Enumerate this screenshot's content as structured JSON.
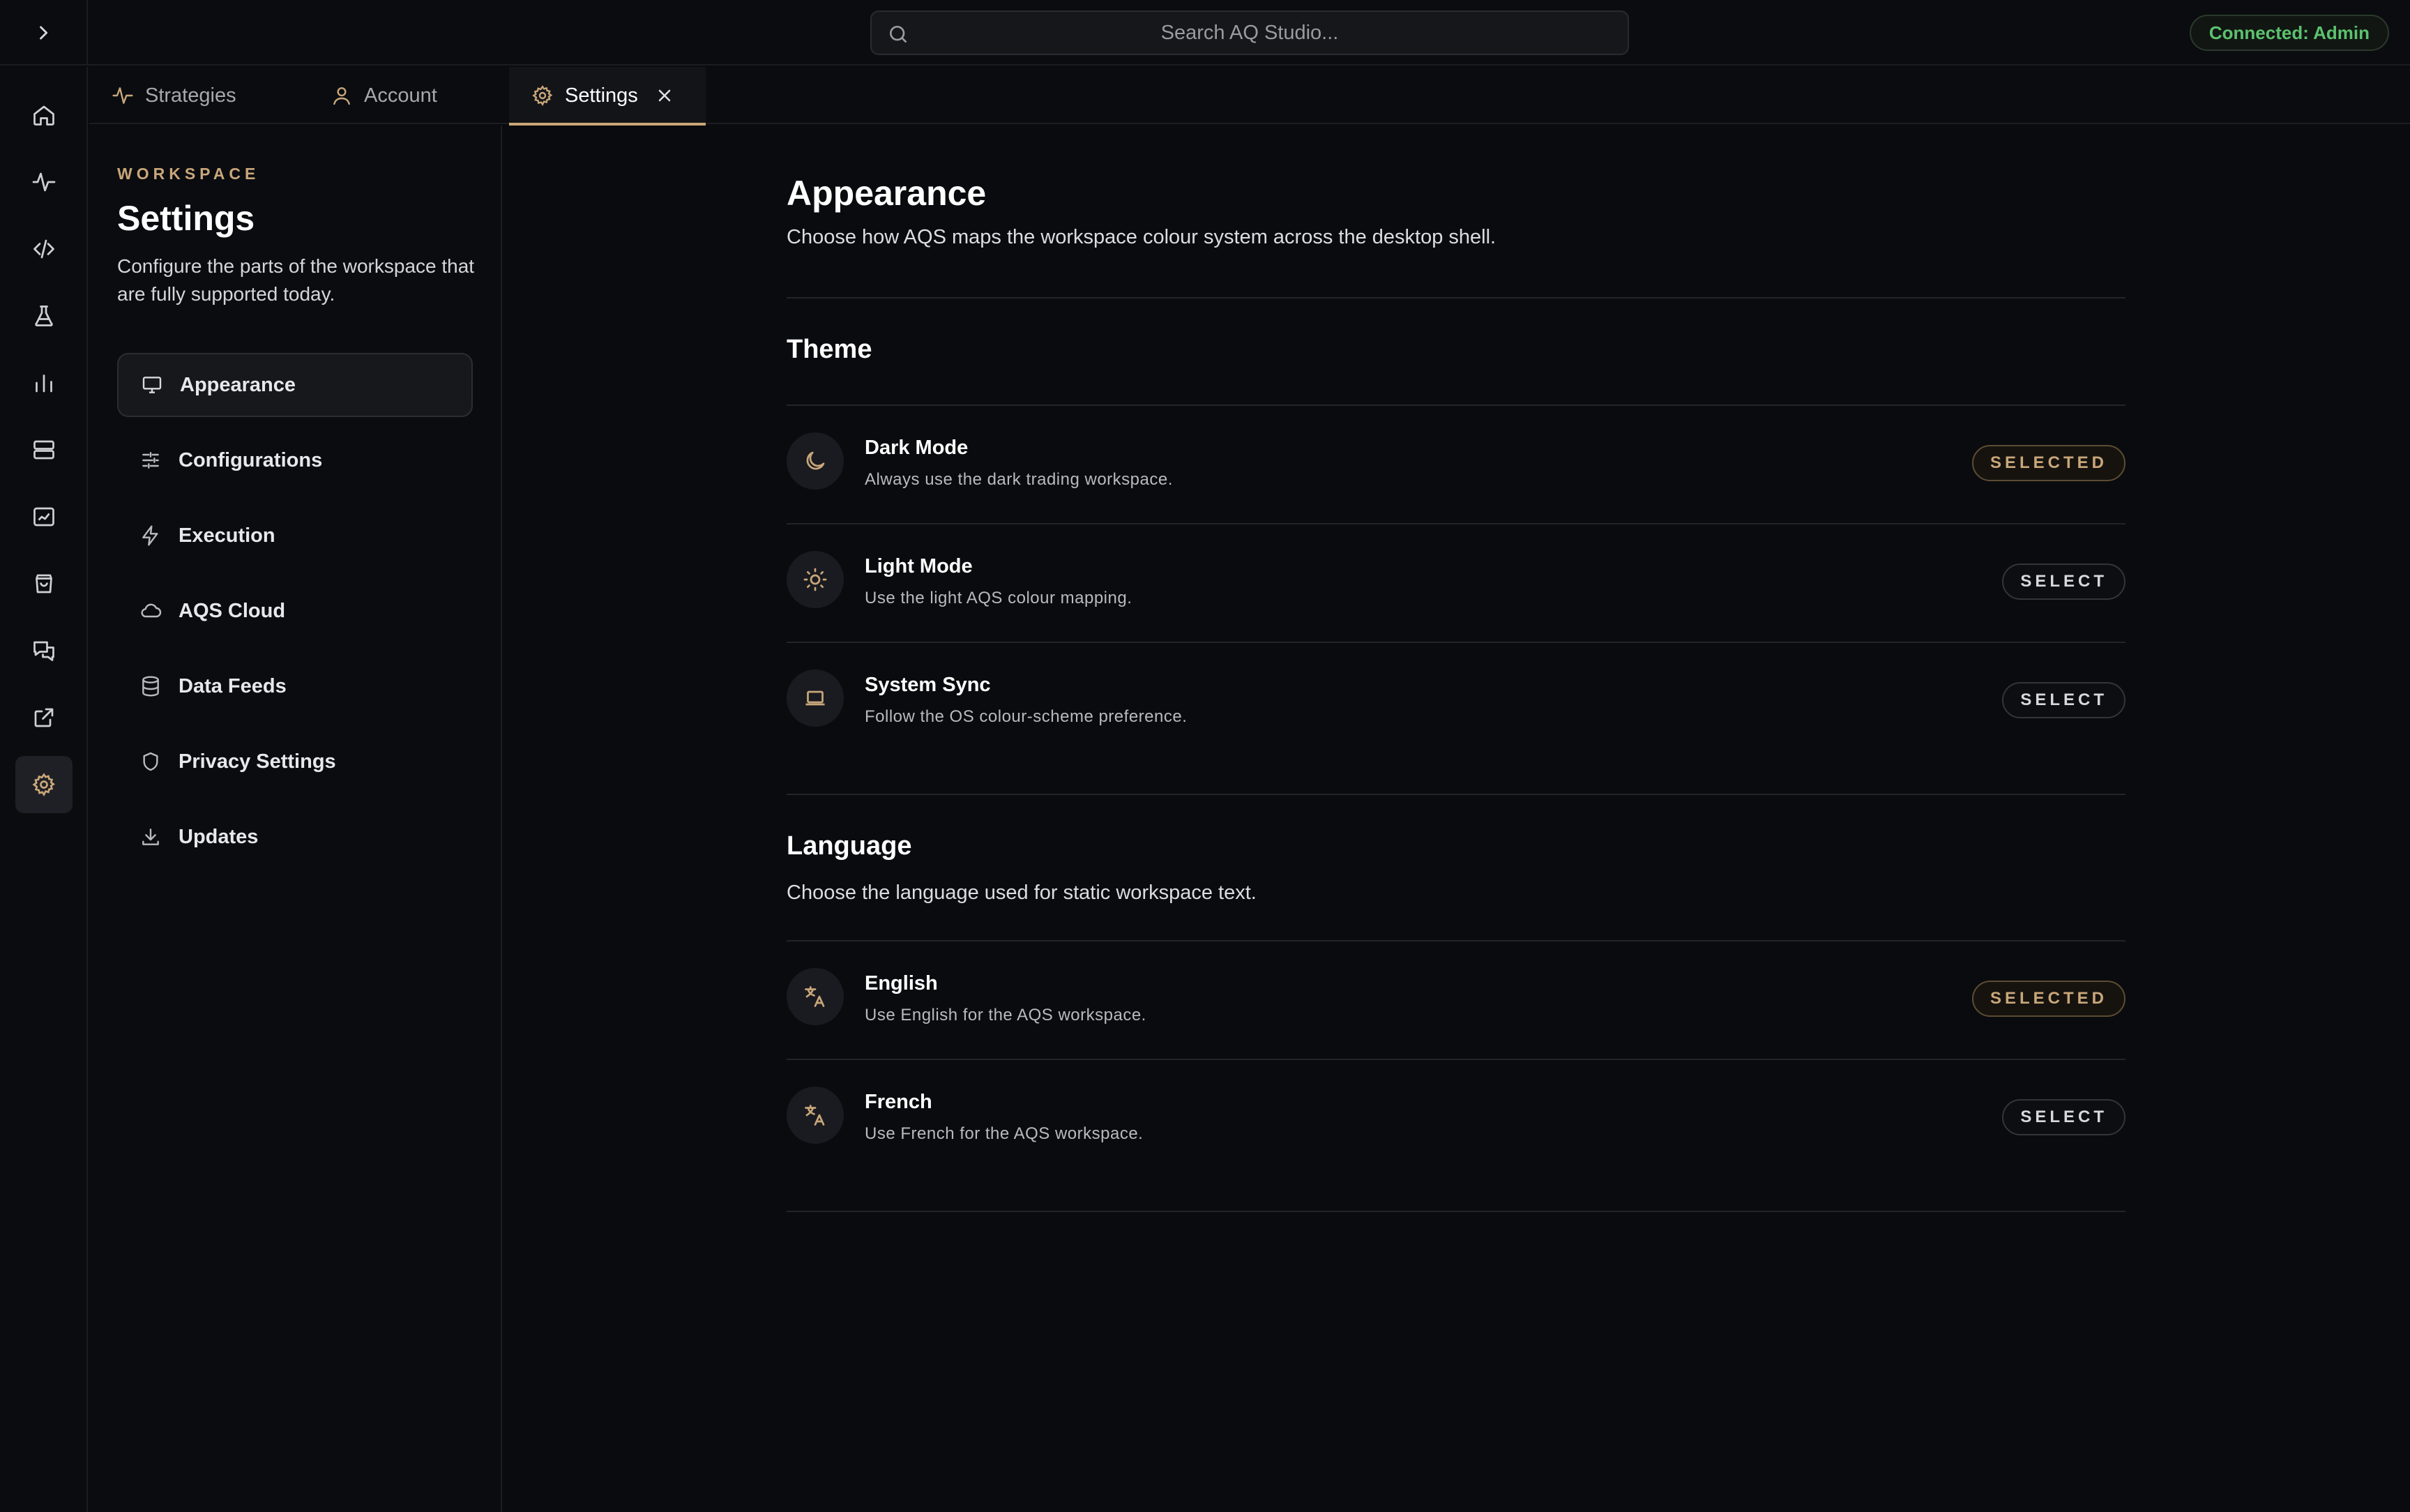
{
  "search": {
    "placeholder": "Search AQ Studio..."
  },
  "connection": {
    "label": "Connected: Admin",
    "color": "#5cc26e"
  },
  "accent": "#c9a77a",
  "rail": {
    "items": [
      {
        "icon": "home-icon"
      },
      {
        "icon": "activity-icon"
      },
      {
        "icon": "code-icon"
      },
      {
        "icon": "flask-icon"
      },
      {
        "icon": "bar-chart-icon"
      },
      {
        "icon": "server-icon"
      },
      {
        "icon": "line-chart-icon"
      },
      {
        "icon": "shopping-bag-icon"
      },
      {
        "icon": "messages-icon"
      },
      {
        "icon": "external-link-icon"
      },
      {
        "icon": "gear-icon",
        "active": true
      }
    ]
  },
  "tabs": [
    {
      "label": "Strategies",
      "icon": "activity-icon"
    },
    {
      "label": "Account",
      "icon": "user-icon"
    },
    {
      "label": "Settings",
      "icon": "gear-icon",
      "active": true
    }
  ],
  "sidebar": {
    "eyebrow": "WORKSPACE",
    "title": "Settings",
    "description": "Configure the parts of the workspace that are fully supported today.",
    "items": [
      {
        "label": "Appearance",
        "icon": "monitor-icon",
        "active": true
      },
      {
        "label": "Configurations",
        "icon": "sliders-icon"
      },
      {
        "label": "Execution",
        "icon": "bolt-icon"
      },
      {
        "label": "AQS Cloud",
        "icon": "cloud-icon"
      },
      {
        "label": "Data Feeds",
        "icon": "database-icon"
      },
      {
        "label": "Privacy Settings",
        "icon": "shield-icon"
      },
      {
        "label": "Updates",
        "icon": "download-icon"
      }
    ]
  },
  "main": {
    "title": "Appearance",
    "description": "Choose how AQS maps the workspace colour system across the desktop shell.",
    "theme": {
      "heading": "Theme",
      "options": [
        {
          "title": "Dark Mode",
          "desc": "Always use the dark trading workspace.",
          "button": "SELECTED",
          "selected": true,
          "icon": "moon-icon"
        },
        {
          "title": "Light Mode",
          "desc": "Use the light AQS colour mapping.",
          "button": "SELECT",
          "selected": false,
          "icon": "sun-icon"
        },
        {
          "title": "System Sync",
          "desc": "Follow the OS colour-scheme preference.",
          "button": "SELECT",
          "selected": false,
          "icon": "laptop-icon"
        }
      ]
    },
    "language": {
      "heading": "Language",
      "description": "Choose the language used for static workspace text.",
      "options": [
        {
          "title": "English",
          "desc": "Use English for the AQS workspace.",
          "button": "SELECTED",
          "selected": true,
          "icon": "translate-icon"
        },
        {
          "title": "French",
          "desc": "Use French for the AQS workspace.",
          "button": "SELECT",
          "selected": false,
          "icon": "translate-icon"
        }
      ]
    }
  }
}
